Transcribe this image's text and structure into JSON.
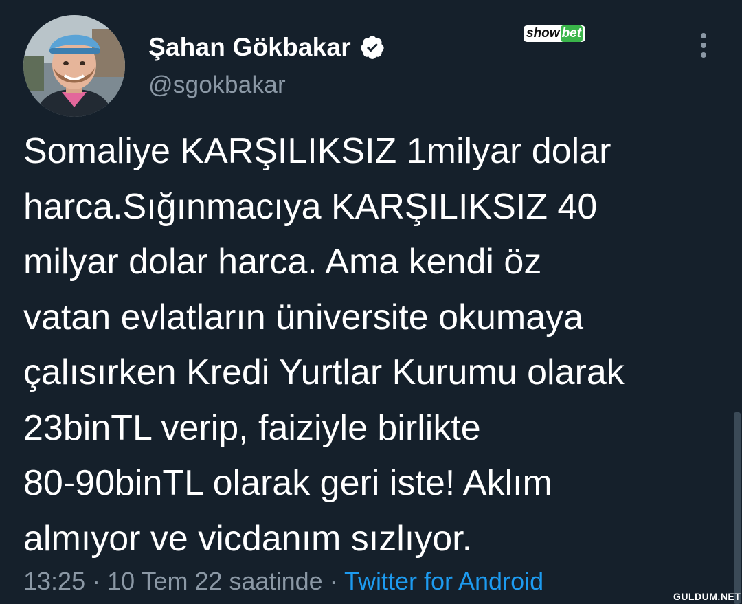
{
  "tweet": {
    "author": {
      "display_name": "Şahan Gökbakar",
      "handle": "@sgokbakar",
      "verified_icon": "verified-badge-icon",
      "avatar_icon": "profile-photo"
    },
    "text_lines": [
      "Somaliye KARŞILIKSIZ 1milyar dolar",
      "harca.Sığınmacıya KARŞILIKSIZ 40",
      "milyar dolar harca. Ama kendi öz",
      "vatan evlatların üniversite okumaya",
      "çalısırken Kredi Yurtlar Kurumu olarak",
      "23binTL verip, faiziyle birlikte",
      "80-90binTL olarak geri iste! Aklım",
      "almıyor ve vicdanım sızlıyor."
    ],
    "timestamp": "13:25 · 10 Tem 22 saatinde",
    "separator": " · ",
    "source": "Twitter for Android",
    "more_icon": "more-options-icon"
  },
  "watermarks": {
    "top_part1": "show",
    "top_part2": "bet",
    "bottom": "GULDUM.NET"
  },
  "colors": {
    "background": "#15202b",
    "text_primary": "#ffffff",
    "text_secondary": "#8b98a5",
    "link": "#1d9bf0",
    "verified": "#ffffff"
  }
}
